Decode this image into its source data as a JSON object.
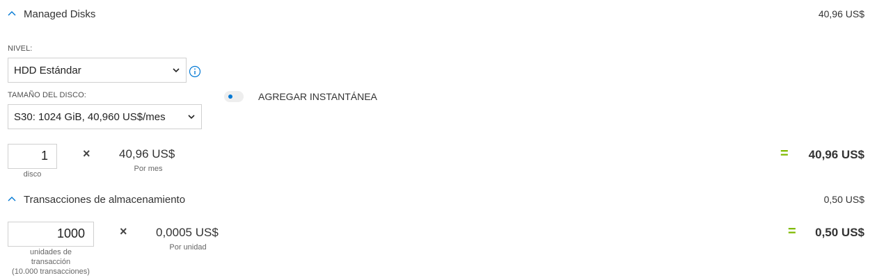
{
  "managed_disks": {
    "title": "Managed Disks",
    "total": "40,96 US$",
    "nivel_label": "NIVEL:",
    "nivel_value": "HDD Estándar",
    "size_label": "TAMAÑO DEL DISCO:",
    "size_value": "S30: 1024 GiB, 40,960 US$/mes",
    "snapshot_label": "AGREGAR INSTANTÁNEA",
    "snapshot_enabled": false,
    "quantity": "1",
    "quantity_unit": "disco",
    "times": "×",
    "unit_price": "40,96 US$",
    "unit_price_sub": "Por mes",
    "equals": "=",
    "line_total": "40,96 US$"
  },
  "storage_transactions": {
    "title": "Transacciones de almacenamiento",
    "total": "0,50 US$",
    "quantity": "1000",
    "quantity_unit_lines": [
      "unidades de",
      "transacción",
      "(10.000 transacciones)"
    ],
    "times": "×",
    "unit_price": "0,0005 US$",
    "unit_price_sub": "Por unidad",
    "equals": "=",
    "line_total": "0,50 US$"
  },
  "icons": {
    "collapse": "chevron-up-icon",
    "dropdown": "chevron-down-icon",
    "info": "info-icon"
  },
  "colors": {
    "accent": "#0078d4",
    "equals": "#7fba00"
  }
}
